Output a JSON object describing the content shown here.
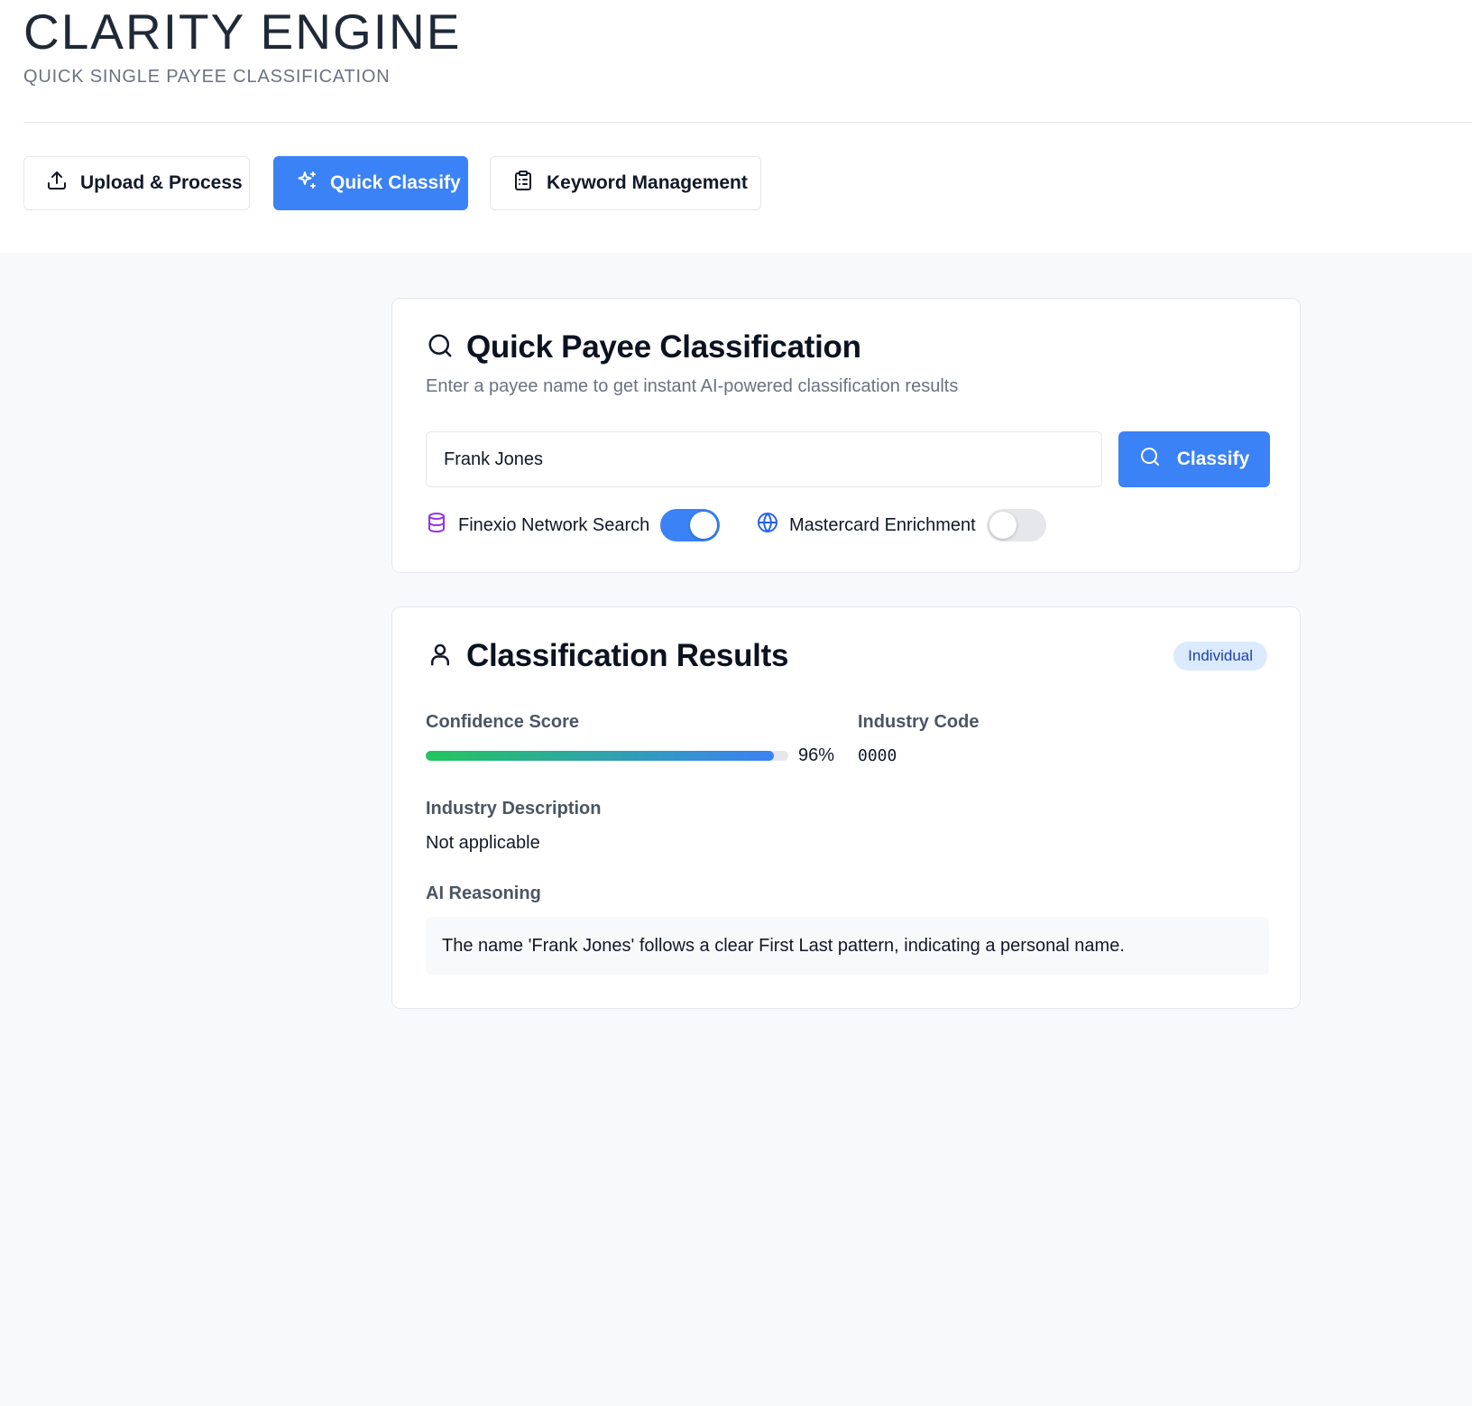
{
  "header": {
    "title": "CLARITY ENGINE",
    "subtitle": "QUICK SINGLE PAYEE CLASSIFICATION"
  },
  "nav": {
    "upload_label": "Upload & Process",
    "quick_label": "Quick Classify",
    "keyword_label": "Keyword Management",
    "active": "Quick Classify"
  },
  "classify_card": {
    "title": "Quick Payee Classification",
    "description": "Enter a payee name to get instant AI-powered classification results",
    "input_value": "Frank Jones",
    "button_label": "Classify",
    "options": [
      {
        "label": "Finexio Network Search",
        "enabled": true,
        "icon": "database-icon"
      },
      {
        "label": "Mastercard Enrichment",
        "enabled": false,
        "icon": "globe-icon"
      }
    ]
  },
  "results_card": {
    "title": "Classification Results",
    "badge": "Individual",
    "confidence_label": "Confidence Score",
    "confidence_value": 96,
    "confidence_text": "96%",
    "industry_code_label": "Industry Code",
    "industry_code": "0000",
    "industry_description_label": "Industry Description",
    "industry_description": "Not applicable",
    "ai_reasoning_label": "AI Reasoning",
    "ai_reasoning": "The name 'Frank Jones' follows a clear First Last pattern, indicating a personal name."
  },
  "colors": {
    "accent": "#3b82f6",
    "progress_start": "#22c55e",
    "progress_end": "#3b82f6",
    "database_icon": "#9333ea",
    "globe_icon": "#2563eb"
  }
}
